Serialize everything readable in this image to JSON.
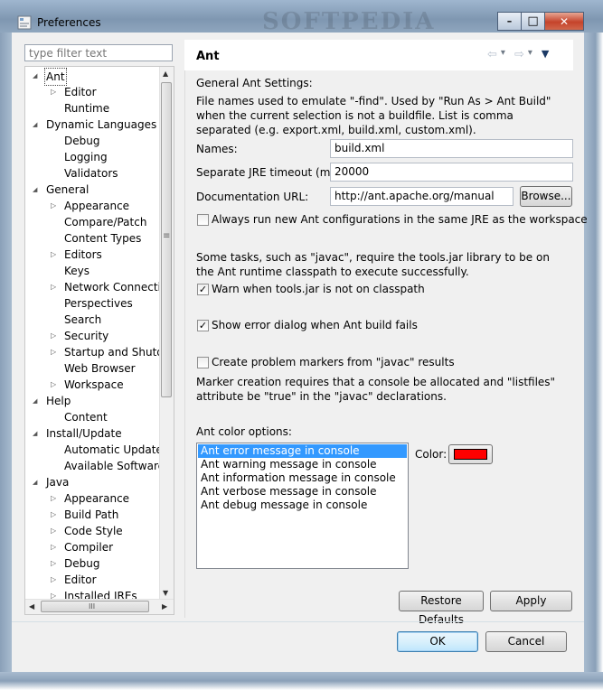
{
  "window": {
    "title": "Preferences",
    "watermark": "SOFTPEDIA",
    "controls": {
      "minimize": "–",
      "maximize": "□",
      "close": "✕"
    }
  },
  "filter": {
    "placeholder": "type filter text"
  },
  "tree": [
    {
      "label": "Ant",
      "level": 0,
      "expander": "open",
      "selected": true
    },
    {
      "label": "Editor",
      "level": 1,
      "expander": "closed"
    },
    {
      "label": "Runtime",
      "level": 1,
      "expander": "none"
    },
    {
      "label": "Dynamic Languages",
      "level": 0,
      "expander": "open"
    },
    {
      "label": "Debug",
      "level": 1,
      "expander": "none"
    },
    {
      "label": "Logging",
      "level": 1,
      "expander": "none"
    },
    {
      "label": "Validators",
      "level": 1,
      "expander": "none"
    },
    {
      "label": "General",
      "level": 0,
      "expander": "open"
    },
    {
      "label": "Appearance",
      "level": 1,
      "expander": "closed"
    },
    {
      "label": "Compare/Patch",
      "level": 1,
      "expander": "none"
    },
    {
      "label": "Content Types",
      "level": 1,
      "expander": "none"
    },
    {
      "label": "Editors",
      "level": 1,
      "expander": "closed"
    },
    {
      "label": "Keys",
      "level": 1,
      "expander": "none"
    },
    {
      "label": "Network Connection",
      "level": 1,
      "expander": "closed"
    },
    {
      "label": "Perspectives",
      "level": 1,
      "expander": "none"
    },
    {
      "label": "Search",
      "level": 1,
      "expander": "none"
    },
    {
      "label": "Security",
      "level": 1,
      "expander": "closed"
    },
    {
      "label": "Startup and Shutdown",
      "level": 1,
      "expander": "closed"
    },
    {
      "label": "Web Browser",
      "level": 1,
      "expander": "none"
    },
    {
      "label": "Workspace",
      "level": 1,
      "expander": "closed"
    },
    {
      "label": "Help",
      "level": 0,
      "expander": "open"
    },
    {
      "label": "Content",
      "level": 1,
      "expander": "none"
    },
    {
      "label": "Install/Update",
      "level": 0,
      "expander": "open"
    },
    {
      "label": "Automatic Updates",
      "level": 1,
      "expander": "none"
    },
    {
      "label": "Available Software Sites",
      "level": 1,
      "expander": "none"
    },
    {
      "label": "Java",
      "level": 0,
      "expander": "open"
    },
    {
      "label": "Appearance",
      "level": 1,
      "expander": "closed"
    },
    {
      "label": "Build Path",
      "level": 1,
      "expander": "closed"
    },
    {
      "label": "Code Style",
      "level": 1,
      "expander": "closed"
    },
    {
      "label": "Compiler",
      "level": 1,
      "expander": "closed"
    },
    {
      "label": "Debug",
      "level": 1,
      "expander": "closed"
    },
    {
      "label": "Editor",
      "level": 1,
      "expander": "closed"
    },
    {
      "label": "Installed JREs",
      "level": 1,
      "expander": "closed"
    }
  ],
  "panel": {
    "title": "Ant",
    "nav": {
      "back": "⇦",
      "forward": "⇨",
      "dropdown": "▾",
      "menu": "▼"
    },
    "general_heading": "General Ant Settings:",
    "find_description": "File names used to emulate \"-find\". Used by \"Run As > Ant Build\" when the current selection is not a buildfile. List is comma separated (e.g. export.xml, build.xml, custom.xml).",
    "names_label": "Names:",
    "names_value": "build.xml",
    "timeout_label": "Separate JRE timeout (ms):",
    "timeout_value": "20000",
    "docurl_label": "Documentation URL:",
    "docurl_value": "http://ant.apache.org/manual",
    "browse_label": "Browse...",
    "same_jre_label": "Always run new Ant configurations in the same JRE as the workspace",
    "same_jre_checked": false,
    "tools_description": "Some tasks, such as \"javac\", require the tools.jar library to be on the Ant runtime classpath to execute successfully.",
    "warn_tools_label": "Warn when tools.jar is not on classpath",
    "warn_tools_checked": true,
    "show_error_label": "Show error dialog when Ant build fails",
    "show_error_checked": true,
    "problem_markers_label": "Create problem markers from \"javac\" results",
    "problem_markers_checked": false,
    "marker_description": "Marker creation requires that a console be allocated and \"listfiles\" attribute be \"true\" in the \"javac\" declarations.",
    "color_options_label": "Ant color options:",
    "color_items": [
      "Ant error message in console",
      "Ant warning message in console",
      "Ant information message in console",
      "Ant verbose message in console",
      "Ant debug message in console"
    ],
    "color_selected_index": 0,
    "color_label": "Color:",
    "color_value": "#ff0000",
    "restore_defaults_label": "Restore Defaults",
    "apply_label": "Apply"
  },
  "footer": {
    "ok_label": "OK",
    "cancel_label": "Cancel"
  },
  "tree_scroll": {
    "up": "▲",
    "down": "▼",
    "left": "◀",
    "right": "▶",
    "grip_h": "III",
    "grip_v": "≡"
  }
}
